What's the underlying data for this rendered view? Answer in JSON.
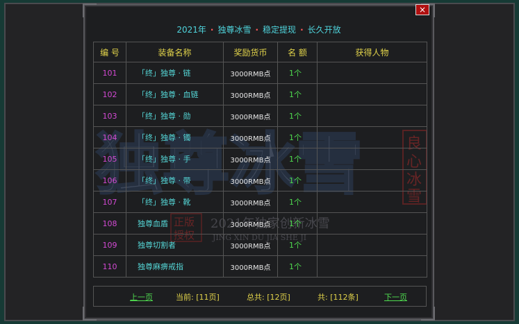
{
  "window": {
    "title_parts": [
      "2021年",
      "独尊冰雪",
      "稳定提现",
      "长久开放"
    ],
    "title_separator": "·",
    "close_label": "×"
  },
  "table": {
    "headers": [
      "编 号",
      "装备名称",
      "奖励货币",
      "名 额",
      "获得人物"
    ],
    "rows": [
      {
        "id": "101",
        "name": "「终」独尊 · 链",
        "reward": "3000RMB点",
        "quota": "1个",
        "winner": ""
      },
      {
        "id": "102",
        "name": "「终」独尊 · 血链",
        "reward": "3000RMB点",
        "quota": "1个",
        "winner": ""
      },
      {
        "id": "103",
        "name": "「终」独尊 · 勋",
        "reward": "3000RMB点",
        "quota": "1个",
        "winner": ""
      },
      {
        "id": "104",
        "name": "「终」独尊 · 镯",
        "reward": "3000RMB点",
        "quota": "1个",
        "winner": ""
      },
      {
        "id": "105",
        "name": "「终」独尊 · 手",
        "reward": "3000RMB点",
        "quota": "1个",
        "winner": ""
      },
      {
        "id": "106",
        "name": "「终」独尊 · 带",
        "reward": "3000RMB点",
        "quota": "1个",
        "winner": ""
      },
      {
        "id": "107",
        "name": "「终」独尊 · 靴",
        "reward": "3000RMB点",
        "quota": "1个",
        "winner": ""
      },
      {
        "id": "108",
        "name": "独尊血盾",
        "reward": "3000RMB点",
        "quota": "1个",
        "winner": ""
      },
      {
        "id": "109",
        "name": "独尊切割者",
        "reward": "3000RMB点",
        "quota": "1个",
        "winner": ""
      },
      {
        "id": "110",
        "name": "独尊麻痹戒指",
        "reward": "3000RMB点",
        "quota": "1个",
        "winner": ""
      }
    ]
  },
  "footer": {
    "prev_label": "上一页",
    "current_label": "当前: [11页]",
    "total_pages_label": "总共: [12页]",
    "total_items_label": "共: [112条]",
    "next_label": "下一页"
  },
  "background_art": {
    "big_title": "独尊冰雪",
    "badge": "良心冰雪",
    "authorized": "正版授权",
    "subtitle": "2021年独家创新冰雪",
    "pinyin": "JING XIN DU JIA SHE JI"
  },
  "colors": {
    "title": "#4fd4dc",
    "separator": "#ff5a5a",
    "header": "#e0d24a",
    "id": "#d44ad4",
    "name": "#55d6d6",
    "quota": "#4fdc4f",
    "close_button": "#b01010"
  }
}
